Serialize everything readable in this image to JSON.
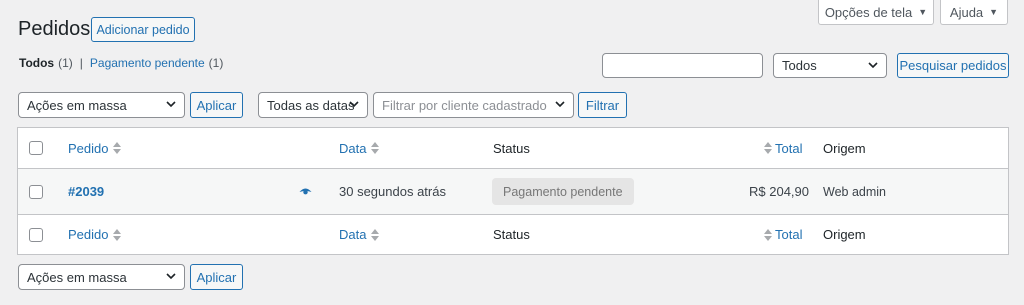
{
  "screen_meta": {
    "options_label": "Opções de tela",
    "help_label": "Ajuda"
  },
  "header": {
    "title": "Pedidos",
    "add_button": "Adicionar pedido"
  },
  "views": [
    {
      "label": "Todos",
      "count": "(1)"
    },
    {
      "label": "Pagamento pendente",
      "count": "(1)"
    }
  ],
  "views_separator": "|",
  "search": {
    "value": "",
    "status_selected": "Todos",
    "button": "Pesquisar pedidos"
  },
  "filters": {
    "bulk_actions": "Ações em massa",
    "apply": "Aplicar",
    "dates": "Todas as datas",
    "customer_placeholder": "Filtrar por cliente cadastrado",
    "filter": "Filtrar"
  },
  "table": {
    "columns": {
      "order": "Pedido",
      "date": "Data",
      "status": "Status",
      "total": "Total",
      "origin": "Origem"
    },
    "rows": [
      {
        "order": "#2039",
        "date": "30 segundos atrás",
        "status": "Pagamento pendente",
        "total": "R$ 204,90",
        "origin": "Web admin"
      }
    ]
  },
  "bottom": {
    "bulk_actions": "Ações em massa",
    "apply": "Aplicar"
  },
  "colors": {
    "accent": "#2271b1",
    "background": "#f0f0f1",
    "status_badge_bg": "#e5e5e5"
  }
}
